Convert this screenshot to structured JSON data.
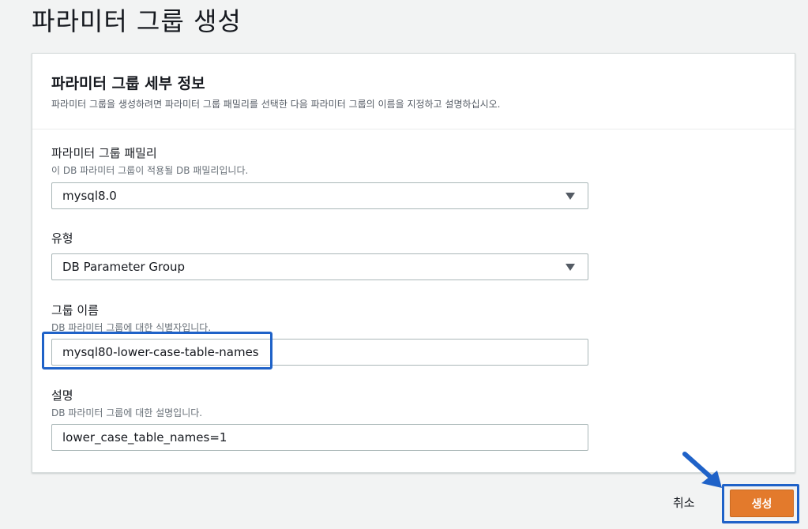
{
  "page": {
    "title": "파라미터 그룹 생성"
  },
  "panel": {
    "title": "파라미터 그룹 세부 정보",
    "description": "파라미터 그룹을 생성하려면 파라미터 그룹 패밀리를 선택한 다음 파라미터 그룹의 이름을 지정하고 설명하십시오."
  },
  "form": {
    "family": {
      "label": "파라미터 그룹 패밀리",
      "hint": "이 DB 파라미터 그룹이 적용될 DB 패밀리입니다.",
      "value": "mysql8.0"
    },
    "type": {
      "label": "유형",
      "value": "DB Parameter Group"
    },
    "group_name": {
      "label": "그룹 이름",
      "hint": "DB 파라미터 그룹에 대한 식별자입니다.",
      "value": "mysql80-lower-case-table-names"
    },
    "description": {
      "label": "설명",
      "hint": "DB 파라미터 그룹에 대한 설명입니다.",
      "value": "lower_case_table_names=1"
    }
  },
  "actions": {
    "cancel_label": "취소",
    "create_label": "생성"
  },
  "colors": {
    "primary_button": "#e37a2c",
    "highlight": "#1f62c8"
  },
  "icons": [
    "caret-down-icon",
    "pointer-arrow-icon"
  ]
}
